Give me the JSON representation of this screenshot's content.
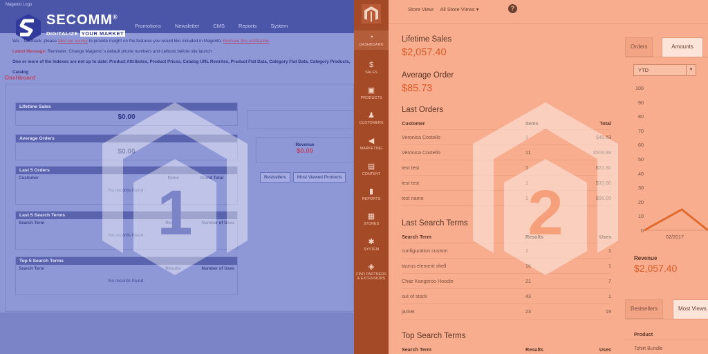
{
  "left_panel": {
    "logo_alt": "Magento Logo",
    "nav": [
      "Promotions",
      "Newsletter",
      "CMS",
      "Reports",
      "System"
    ],
    "messages": {
      "line1_pre": "We",
      "line1_rest": "... feedback, please",
      "line1_link": "take our survey",
      "line1_mid": "to provide insight on the features you would like included in Magento.",
      "line1_remove": "Remove this notification",
      "latest_label": "Latest Message:",
      "latest_text": "Reminder: Change Magento`s default phone numbers and callouts before site launch",
      "indexes_text": "One or more of the Indexes are not up to date: Product Attributes, Product Prices, Catalog URL Rewrites, Product Flat Data, Category Flat Data, Category Products, Catalog"
    },
    "dashboard_title": "Dashboard",
    "lifetime_sales": {
      "label": "Lifetime Sales",
      "value": "$0.00"
    },
    "average_orders": {
      "label": "Average Orders",
      "value": "$0.00"
    },
    "last_orders": {
      "label": "Last 5 Orders",
      "cols": [
        "Customer",
        "Items",
        "Grand Total"
      ],
      "empty": "No records found."
    },
    "last_search": {
      "label": "Last 5 Search Terms",
      "cols": [
        "Search Term",
        "Results",
        "Number of Uses"
      ],
      "empty": "No records found."
    },
    "top_search": {
      "label": "Top 5 Search Terms",
      "cols": [
        "Search Term",
        "Results",
        "Number of Uses"
      ],
      "empty": "No records found."
    },
    "revenue": {
      "label": "Revenue",
      "value": "$0.00"
    },
    "tabs": [
      "Bestsellers",
      "Most Viewed Products"
    ],
    "badge_number": "1"
  },
  "brand": {
    "name": "SECOMM",
    "reg": "®",
    "tagline_a": "DIGITALIZE",
    "tagline_b": "YOUR MARKET"
  },
  "right_panel": {
    "sidebar": [
      {
        "icon": "dashboard-icon",
        "glyph": "◔",
        "label": "DASHBOARD"
      },
      {
        "icon": "dollar-icon",
        "glyph": "$",
        "label": "SALES"
      },
      {
        "icon": "box-icon",
        "glyph": "▣",
        "label": "PRODUCTS"
      },
      {
        "icon": "person-icon",
        "glyph": "♟",
        "label": "CUSTOMERS"
      },
      {
        "icon": "megaphone-icon",
        "glyph": "◀",
        "label": "MARKETING"
      },
      {
        "icon": "content-icon",
        "glyph": "▤",
        "label": "CONTENT"
      },
      {
        "icon": "bar-chart-icon",
        "glyph": "▮",
        "label": "REPORTS"
      },
      {
        "icon": "store-icon",
        "glyph": "▦",
        "label": "STORES"
      },
      {
        "icon": "gear-icon",
        "glyph": "✱",
        "label": "SYSTEM"
      },
      {
        "icon": "puzzle-icon",
        "glyph": "◈",
        "label": "FIND PARTNERS\n& EXTENSIONS"
      }
    ],
    "store_view_label": "Store View:",
    "store_view_value": "All Store Views ▾",
    "help_glyph": "?",
    "lifetime_sales": {
      "label": "Lifetime Sales",
      "value": "$2,057.40"
    },
    "average_order": {
      "label": "Average Order",
      "value": "$85.73"
    },
    "last_orders": {
      "label": "Last Orders",
      "cols": [
        "Customer",
        "Items",
        "Total"
      ],
      "rows": [
        [
          "Veronica Costello",
          "1",
          "$46.53"
        ],
        [
          "Veronica Costello",
          "11",
          "$509.88"
        ],
        [
          "test test",
          "1",
          "$21.80"
        ],
        [
          "test test",
          "1",
          "$10.80"
        ],
        [
          "test name",
          "1",
          "$96.00"
        ]
      ]
    },
    "last_search": {
      "label": "Last Search Terms",
      "cols": [
        "Search Term",
        "Results",
        "Uses"
      ],
      "rows": [
        [
          "configuration custom",
          "1",
          "1"
        ],
        [
          "taurus element shell",
          "16",
          "1"
        ],
        [
          "Chaz Kangeroo Hoodie",
          "21",
          "7"
        ],
        [
          "out of stock",
          "43",
          "1"
        ],
        [
          "jacket",
          "23",
          "19"
        ]
      ]
    },
    "top_search": {
      "label": "Top Search Terms",
      "cols": [
        "Search Term",
        "Results",
        "Uses"
      ]
    },
    "chart_tabs": [
      "Orders",
      "Amounts"
    ],
    "period": "YTD",
    "y_ticks": [
      "100",
      "90",
      "80",
      "70",
      "60",
      "50",
      "40",
      "30",
      "20",
      "10",
      "0"
    ],
    "x_tick": "02/2017",
    "revenue": {
      "label": "Revenue",
      "value": "$2,057.40"
    },
    "bottom_tabs": [
      "Bestsellers",
      "Most Views"
    ],
    "product_header": "Product",
    "product_first": "Tshirt Bundle",
    "badge_number": "2"
  }
}
